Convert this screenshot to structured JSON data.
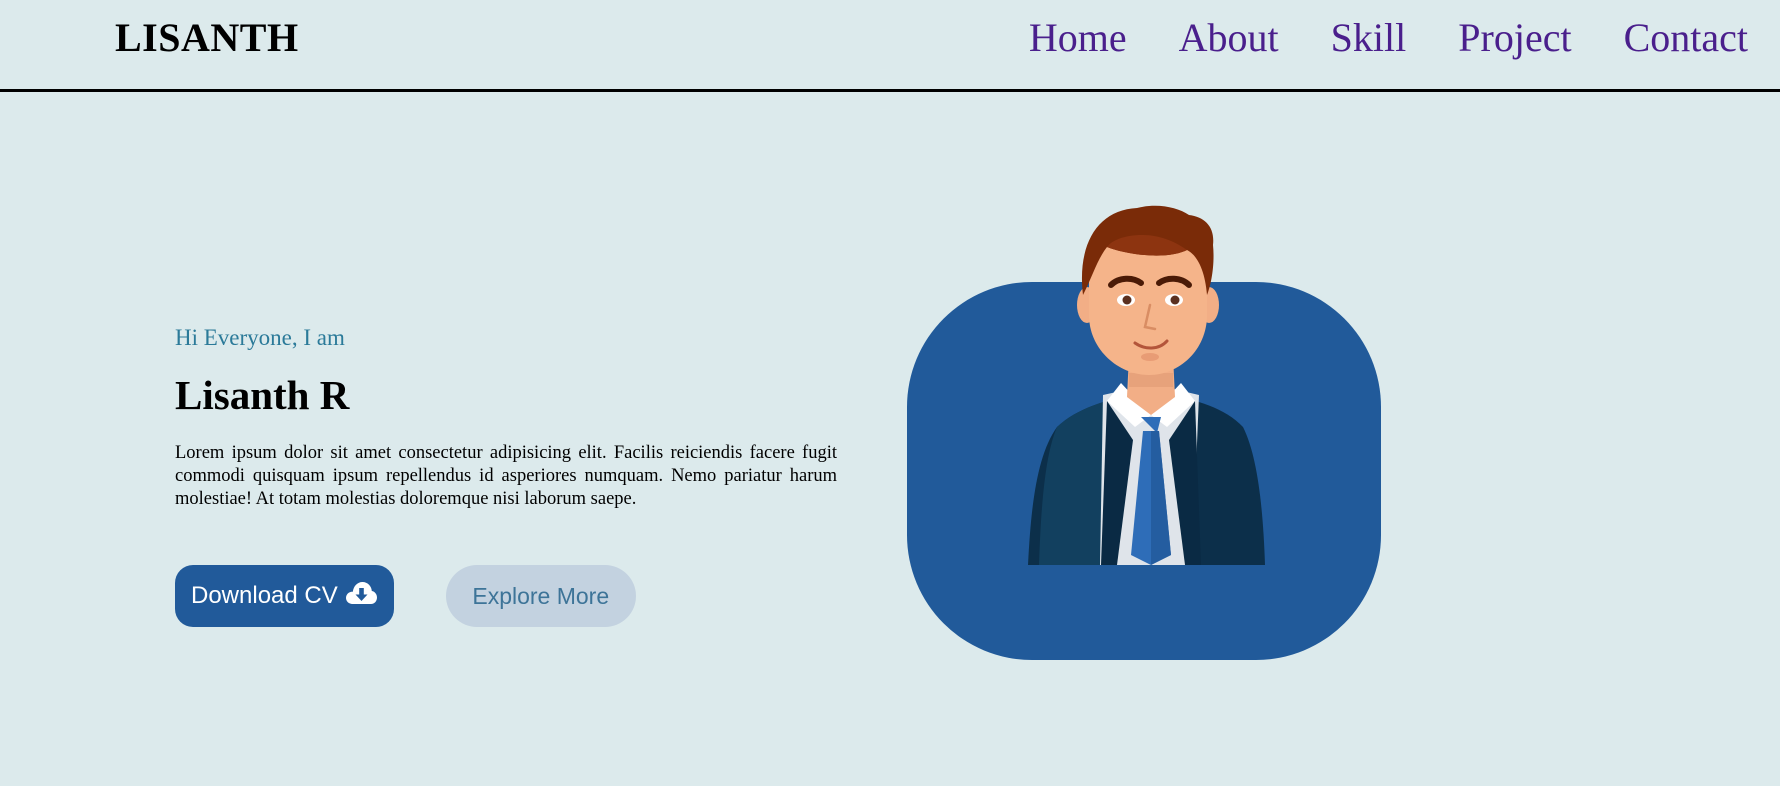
{
  "header": {
    "logo": "LISANTH",
    "nav": [
      "Home",
      "About",
      "Skill",
      "Project",
      "Contact"
    ]
  },
  "hero": {
    "greeting": "Hi Everyone, I am",
    "name": "Lisanth R",
    "bio": "Lorem ipsum dolor sit amet consectetur adipisicing elit. Facilis reiciendis facere fugit commodi quisquam ipsum repellendus id asperiores numquam. Nemo pariatur harum molestiae! At totam molestias doloremque nisi laborum saepe.",
    "download_label": "Download CV",
    "download_icon": "cloud-download-icon",
    "explore_label": "Explore More"
  },
  "colors": {
    "background": "#dceaec",
    "nav_link": "#4a1f8c",
    "greeting": "#2b7a99",
    "primary_button": "#215a9a",
    "secondary_button": "#c3d2e0",
    "avatar_bg": "#215a9a"
  }
}
